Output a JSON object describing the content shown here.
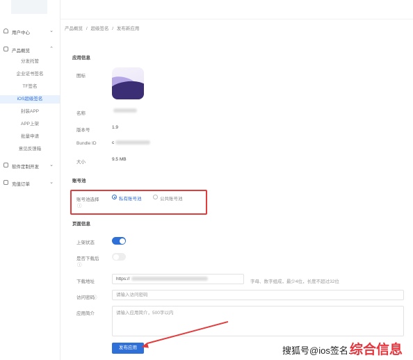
{
  "sidebar": {
    "items": [
      {
        "label": "用户中心",
        "chevron": "⌄"
      },
      {
        "label": "产品概览",
        "chevron": "⌃"
      },
      {
        "label": "软件定制开发",
        "chevron": "⌄"
      },
      {
        "label": "充值订单",
        "chevron": "⌄"
      }
    ],
    "sub_items": [
      "分发托管",
      "企业证书签名",
      "TF签名",
      "iOS超级签名",
      "封装APP",
      "APP上架",
      "批量申请",
      "意见反馈箱"
    ],
    "active_sub_index": 3
  },
  "breadcrumb": [
    "产品概览",
    "/",
    "超级签名",
    "/",
    "发布新应用"
  ],
  "app_info": {
    "section_title": "应用信息",
    "icon_label": "图标",
    "name_label": "名称",
    "version_label": "版本号",
    "version_value": "1.9",
    "bundle_label": "Bundle ID",
    "bundle_value": "c",
    "size_label": "大小",
    "size_value": "9.5 MB"
  },
  "account_pool": {
    "section_title": "账号池",
    "label": "账号池选择",
    "option_private": "私有账号池",
    "option_shared": "公共账号池"
  },
  "page_info": {
    "section_title": "页面信息",
    "shelf_label": "上架状态",
    "shelf_on": true,
    "download_label": "是否下载后",
    "download_on": false,
    "url_label": "下载地址",
    "url_value": "https://",
    "url_hint": "字母、数字组成，最少4位，长度不超过32位",
    "password_label": "访问密码",
    "password_placeholder": "请输入访问密码",
    "desc_label": "应用简介",
    "desc_placeholder": "请输入应用简介，500字以内",
    "publish_button": "发布应用"
  },
  "watermark": {
    "text": "搜狐号@ios签名...",
    "brand": "综合信息"
  },
  "colors": {
    "accent": "#2e6fd8",
    "highlight_red": "#e23b3b",
    "brand_red": "#e8343c"
  }
}
